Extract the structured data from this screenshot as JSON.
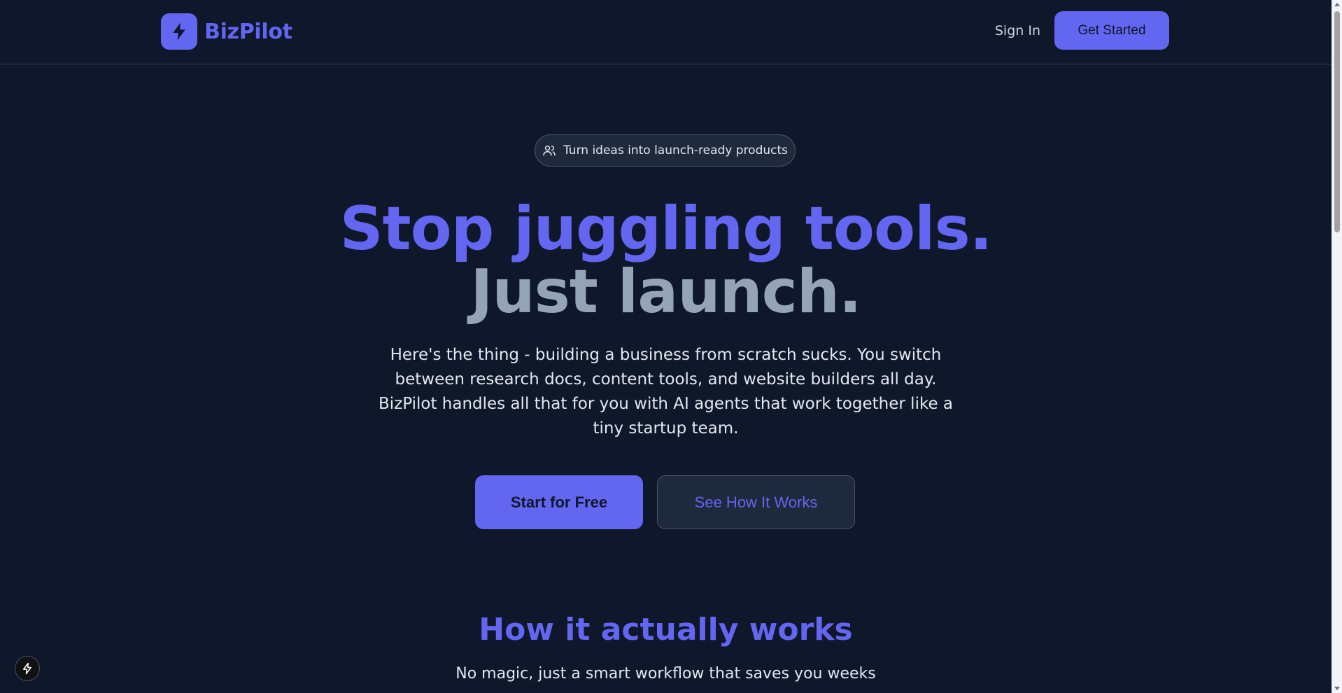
{
  "header": {
    "brand_name": "BizPilot",
    "sign_in_label": "Sign In",
    "get_started_label": "Get Started"
  },
  "hero": {
    "pill_text": "Turn ideas into launch-ready products",
    "headline_line1": "Stop juggling tools.",
    "headline_line2": "Just launch.",
    "subtext": "Here's the thing - building a business from scratch sucks. You switch between research docs, content tools, and website builders all day. BizPilot handles all that for you with AI agents that work together like a tiny startup team.",
    "primary_cta": "Start for Free",
    "secondary_cta": "See How It Works"
  },
  "section": {
    "title": "How it actually works",
    "subtitle": "No magic, just a smart workflow that saves you weeks"
  },
  "icons": {
    "brand": "lightning-bolt-icon",
    "pill": "users-icon",
    "floating": "lightning-bolt-icon"
  },
  "colors": {
    "background": "#0f172a",
    "accent": "#6366f1",
    "muted_heading": "#94a3b8",
    "border": "#334155"
  }
}
